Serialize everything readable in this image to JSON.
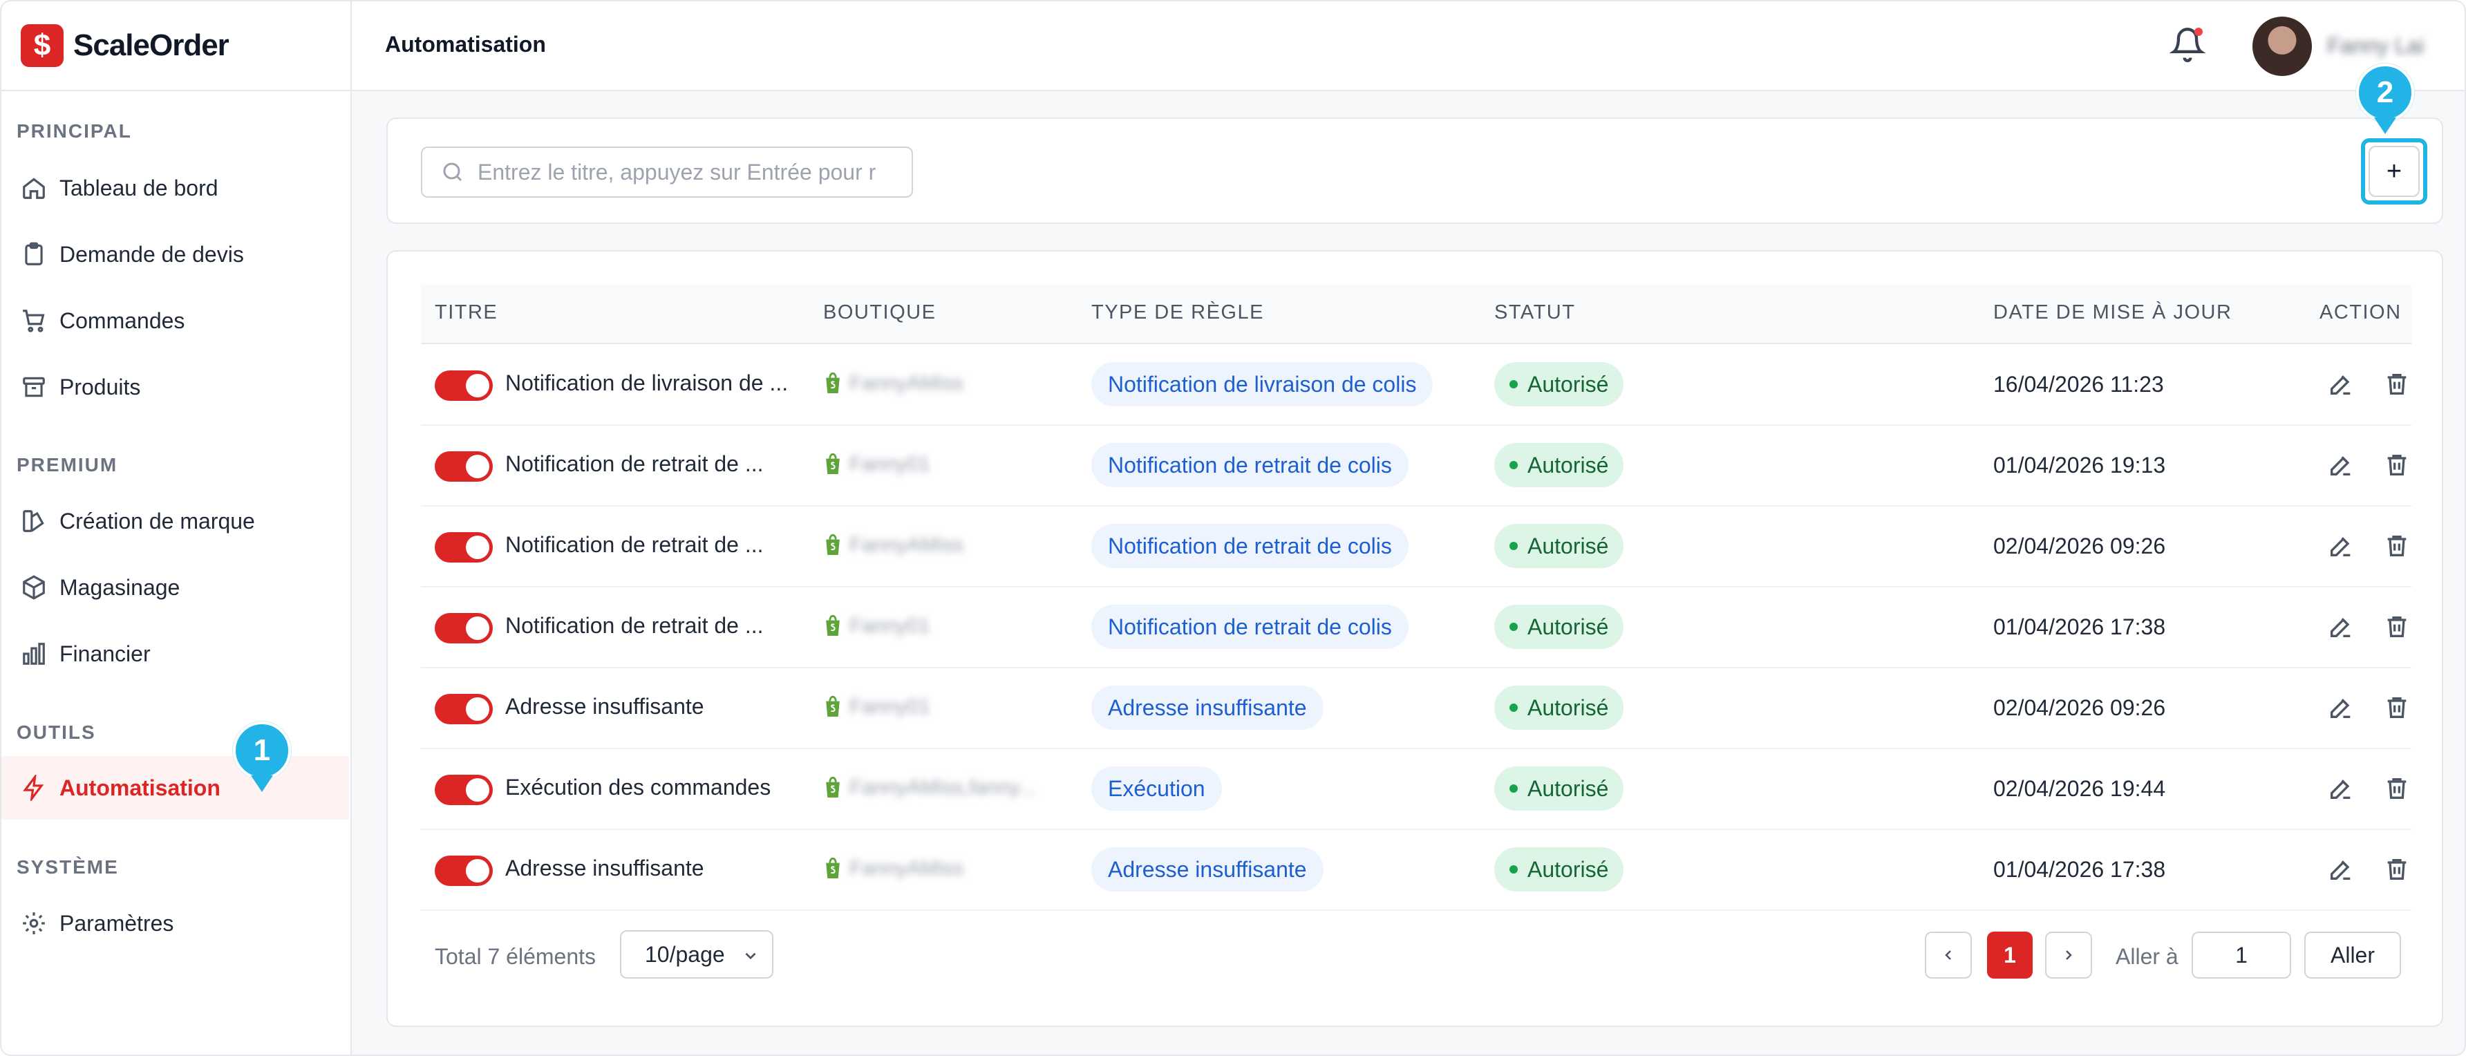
{
  "brand": {
    "name": "ScaleOrder",
    "logo_glyph": "$",
    "accent": "#dc2626"
  },
  "header": {
    "title": "Automatisation",
    "username": "Fanny Lai"
  },
  "sidebar": {
    "sections": [
      {
        "title": "PRINCIPAL"
      },
      {
        "title": "PREMIUM"
      },
      {
        "title": "OUTILS"
      },
      {
        "title": "SYSTÈME"
      }
    ],
    "items": [
      {
        "label": "Tableau de bord",
        "icon": "home-icon"
      },
      {
        "label": "Demande de devis",
        "icon": "clipboard-icon"
      },
      {
        "label": "Commandes",
        "icon": "cart-icon"
      },
      {
        "label": "Produits",
        "icon": "archive-icon"
      },
      {
        "label": "Création de marque",
        "icon": "palette-icon"
      },
      {
        "label": "Magasinage",
        "icon": "box-icon"
      },
      {
        "label": "Financier",
        "icon": "bar-chart-icon"
      },
      {
        "label": "Automatisation",
        "icon": "lightning-icon",
        "active": true
      },
      {
        "label": "Paramètres",
        "icon": "gear-icon"
      }
    ]
  },
  "search": {
    "placeholder": "Entrez le titre, appuyez sur Entrée pour r"
  },
  "add_button": {
    "label": "+"
  },
  "markers": {
    "one": "1",
    "two": "2"
  },
  "table": {
    "headers": [
      "TITRE",
      "BOUTIQUE",
      "TYPE DE RÈGLE",
      "STATUT",
      "DATE DE MISE À JOUR",
      "ACTION"
    ],
    "rows": [
      {
        "enabled": true,
        "title": "Notification de livraison de ...",
        "shop": "FannyAMiss",
        "type": "Notification de livraison de colis",
        "status": "Autorisé",
        "date": "16/04/2026 11:23"
      },
      {
        "enabled": true,
        "title": "Notification de retrait de  ...",
        "shop": "Fanny01",
        "type": "Notification de retrait de colis",
        "status": "Autorisé",
        "date": "01/04/2026 19:13"
      },
      {
        "enabled": true,
        "title": "Notification de retrait de  ...",
        "shop": "FannyAMiss",
        "type": "Notification de retrait de colis",
        "status": "Autorisé",
        "date": "02/04/2026 09:26"
      },
      {
        "enabled": true,
        "title": "Notification de retrait de ...",
        "shop": "Fanny01",
        "type": "Notification de retrait de colis",
        "status": "Autorisé",
        "date": "01/04/2026 17:38"
      },
      {
        "enabled": true,
        "title": "Adresse insuffisante",
        "shop": "Fanny01",
        "type": "Adresse insuffisante",
        "status": "Autorisé",
        "date": "02/04/2026 09:26"
      },
      {
        "enabled": true,
        "title": "Exécution des commandes",
        "shop": "FannyAMiss,fanny...",
        "type": "Exécution",
        "status": "Autorisé",
        "date": "02/04/2026 19:44"
      },
      {
        "enabled": true,
        "title": "Adresse insuffisante",
        "shop": "FannyAMiss",
        "type": "Adresse insuffisante",
        "status": "Autorisé",
        "date": "01/04/2026 17:38"
      }
    ]
  },
  "pagination": {
    "total": "Total 7 éléments",
    "page_size": "10/page",
    "current": "1",
    "goto_label": "Aller à",
    "goto_value": "1",
    "goto_button": "Aller"
  }
}
